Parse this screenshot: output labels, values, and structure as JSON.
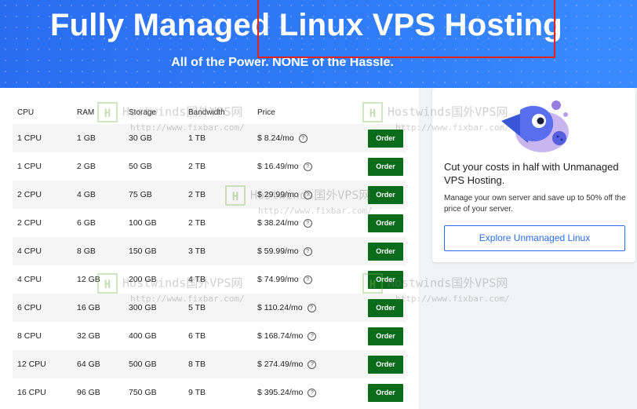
{
  "hero": {
    "title": "Fully Managed Linux VPS Hosting",
    "subtitle": "All of the Power. NONE of the Hassle."
  },
  "table": {
    "headers": {
      "cpu": "CPU",
      "ram": "RAM",
      "storage": "Storage",
      "bandwidth": "Bandwidth",
      "price": "Price"
    },
    "order_label": "Order",
    "help_glyph": "?",
    "rows": [
      {
        "cpu": "1 CPU",
        "ram": "1 GB",
        "storage": "30 GB",
        "bandwidth": "1 TB",
        "price": "$ 8.24/mo"
      },
      {
        "cpu": "1 CPU",
        "ram": "2 GB",
        "storage": "50 GB",
        "bandwidth": "2 TB",
        "price": "$ 16.49/mo"
      },
      {
        "cpu": "2 CPU",
        "ram": "4 GB",
        "storage": "75 GB",
        "bandwidth": "2 TB",
        "price": "$ 29.99/mo"
      },
      {
        "cpu": "2 CPU",
        "ram": "6 GB",
        "storage": "100 GB",
        "bandwidth": "2 TB",
        "price": "$ 38.24/mo"
      },
      {
        "cpu": "4 CPU",
        "ram": "8 GB",
        "storage": "150 GB",
        "bandwidth": "3 TB",
        "price": "$ 59.99/mo"
      },
      {
        "cpu": "4 CPU",
        "ram": "12 GB",
        "storage": "200 GB",
        "bandwidth": "4 TB",
        "price": "$ 74.99/mo"
      },
      {
        "cpu": "6 CPU",
        "ram": "16 GB",
        "storage": "300 GB",
        "bandwidth": "5 TB",
        "price": "$ 110.24/mo"
      },
      {
        "cpu": "8 CPU",
        "ram": "32 GB",
        "storage": "400 GB",
        "bandwidth": "6 TB",
        "price": "$ 168.74/mo"
      },
      {
        "cpu": "12 CPU",
        "ram": "64 GB",
        "storage": "500 GB",
        "bandwidth": "8 TB",
        "price": "$ 274.49/mo"
      },
      {
        "cpu": "16 CPU",
        "ram": "96 GB",
        "storage": "750 GB",
        "bandwidth": "9 TB",
        "price": "$ 395.24/mo"
      }
    ]
  },
  "promo": {
    "title": "Cut your costs in half with Unmanaged VPS Hosting.",
    "text": "Manage your own server and save up to 50% off the price of your server.",
    "button_label": "Explore Unmanaged Linux",
    "mascot_icon": "rocket-fish-mascot-icon"
  },
  "watermark": {
    "logo_glyph": "H",
    "text": "Hostwinds国外VPS网",
    "url": "http://www.fixbar.com/"
  },
  "colors": {
    "hero_blue": "#2f7cf6",
    "order_green": "#0a6b1a",
    "highlight_red": "#e2231a",
    "link_blue": "#2a6cf0"
  }
}
